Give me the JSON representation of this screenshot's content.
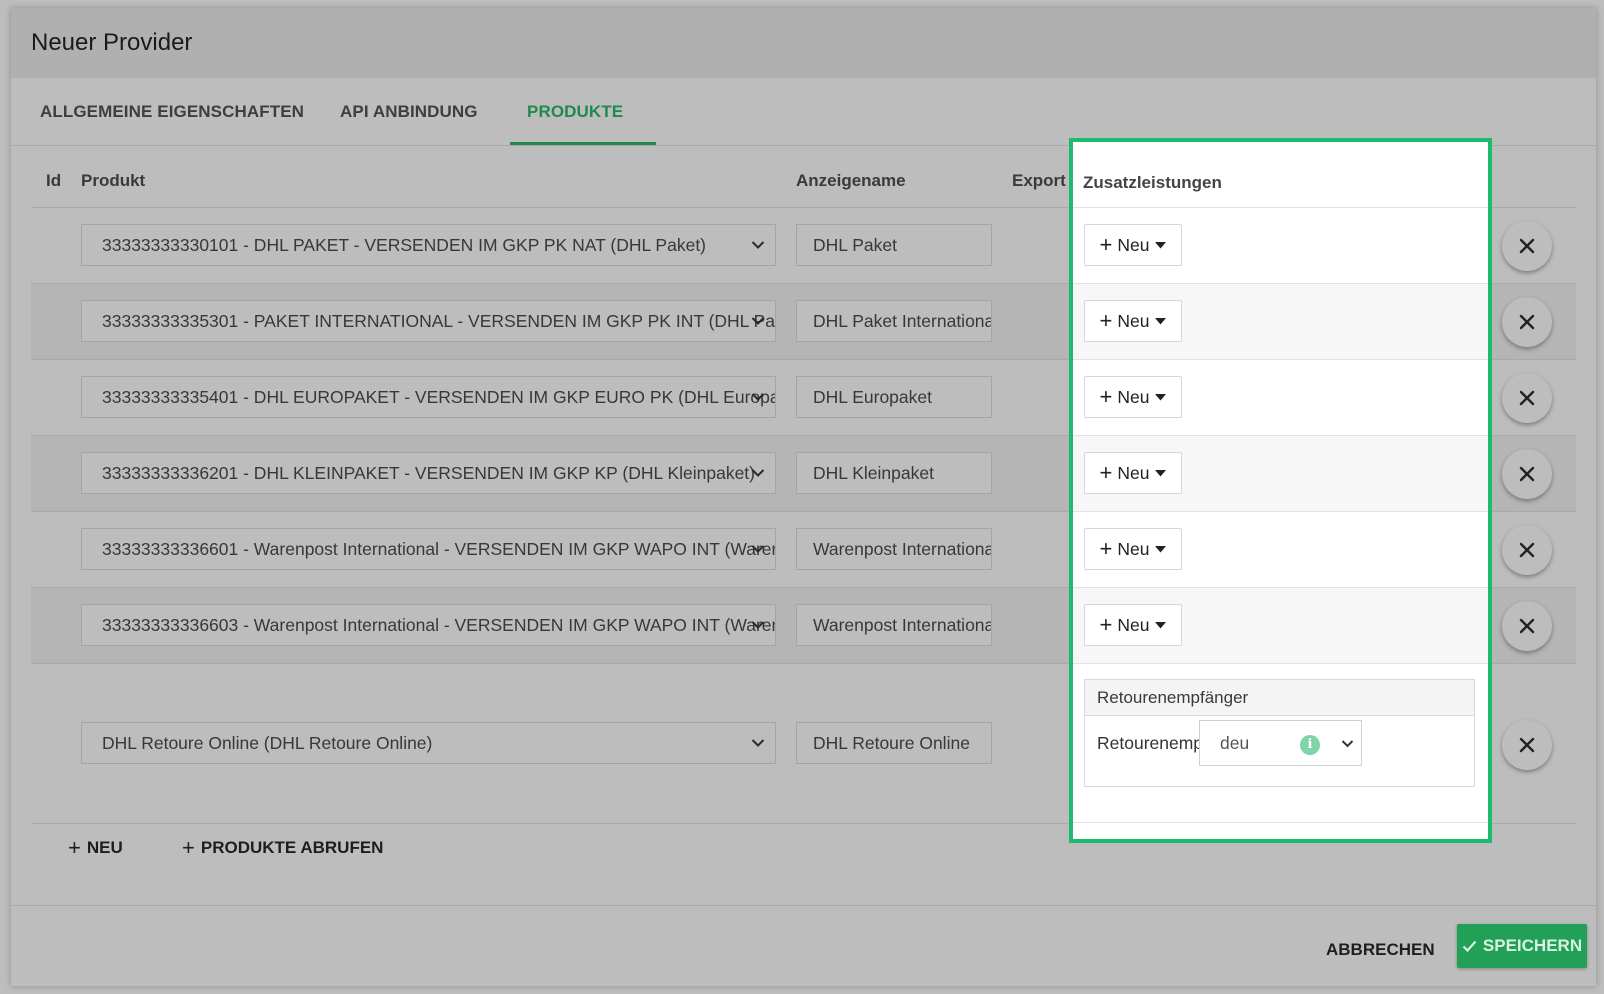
{
  "dialog": {
    "title": "Neuer Provider"
  },
  "tabs": [
    {
      "label": "ALLGEMEINE EIGENSCHAFTEN"
    },
    {
      "label": "API ANBINDUNG"
    },
    {
      "label": "PRODUKTE",
      "active": true
    }
  ],
  "table": {
    "headers": {
      "id": "Id",
      "produkt": "Produkt",
      "anzeigename": "Anzeigename",
      "export": "Export",
      "zusatzleistungen": "Zusatzleistungen"
    },
    "rows": [
      {
        "produkt": "33333333330101 - DHL PAKET - VERSENDEN IM GKP PK NAT (DHL Paket)",
        "anzeigename": "DHL Paket",
        "zusatz_button": "Neu"
      },
      {
        "produkt": "33333333335301 - PAKET INTERNATIONAL - VERSENDEN IM GKP PK INT (DHL Paket International)",
        "anzeigename": "DHL Paket International",
        "zusatz_button": "Neu"
      },
      {
        "produkt": "33333333335401 - DHL EUROPAKET - VERSENDEN IM GKP EURO PK (DHL Europaket)",
        "anzeigename": "DHL Europaket",
        "zusatz_button": "Neu"
      },
      {
        "produkt": "33333333336201 - DHL KLEINPAKET - VERSENDEN IM GKP KP (DHL Kleinpaket)",
        "anzeigename": "DHL Kleinpaket",
        "zusatz_button": "Neu"
      },
      {
        "produkt": "33333333336601 - Warenpost International - VERSENDEN IM GKP WAPO INT (Warenpost International)",
        "anzeigename": "Warenpost International",
        "zusatz_button": "Neu"
      },
      {
        "produkt": "33333333336603 - Warenpost International - VERSENDEN IM GKP WAPO INT (Warenpost International)",
        "anzeigename": "Warenpost International",
        "zusatz_button": "Neu"
      },
      {
        "produkt": "DHL Retoure Online (DHL Retoure Online)",
        "anzeigename": "DHL Retoure Online"
      }
    ],
    "retoure_panel": {
      "title": "Retourenempfänger",
      "field_label": "Retourenempfänger",
      "select_value": "deu"
    }
  },
  "actions": {
    "neu": "NEU",
    "produkte_abrufen": "PRODUKTE ABRUFEN"
  },
  "footer": {
    "cancel": "ABBRECHEN",
    "save": "SPEICHERN"
  },
  "colors": {
    "accent": "#1f8a4c",
    "highlight_border": "#1dbb6d",
    "save_button": "#22a057"
  },
  "icons": {
    "remove": "close-icon",
    "dropdown": "chevron-down-icon",
    "add": "plus-icon",
    "info": "info-icon",
    "save": "check-icon"
  }
}
